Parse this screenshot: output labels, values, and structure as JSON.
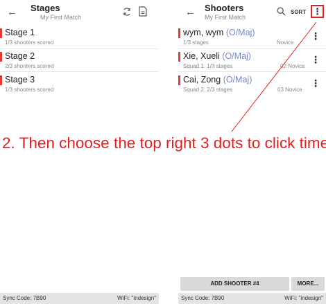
{
  "left": {
    "title": "Stages",
    "subtitle": "My First Match",
    "stages": [
      {
        "name": "Stage 1",
        "scored": "1/3 shooters scored"
      },
      {
        "name": "Stage 2",
        "scored": "2/3 shooters scored"
      },
      {
        "name": "Stage 3",
        "scored": "1/3 shooters scored"
      }
    ],
    "sync_code": "Sync Code: 7B90",
    "wifi": "WiFi: \"indesign\""
  },
  "right": {
    "title": "Shooters",
    "subtitle": "My First Match",
    "sort_label": "SORT",
    "shooters": [
      {
        "name": "wym, wym",
        "division": "(O/Maj)",
        "detail": "1/3 stages",
        "class": "Novice"
      },
      {
        "name": "Xie, Xueli",
        "division": "(O/Maj)",
        "detail": "Squad 1: 1/3 stages",
        "class": "02 Novice"
      },
      {
        "name": "Cai, Zong",
        "division": "(O/Maj)",
        "detail": "Squad 2: 2/3 stages",
        "class": "03 Novice"
      }
    ],
    "add_button": "ADD SHOOTER #4",
    "more_button": "MORE...",
    "sync_code": "Sync Code: 7B90",
    "wifi": "WiFi: \"indesign\""
  },
  "annotation": {
    "text": "2. Then choose the top right 3 dots to click time",
    "color": "#e02020"
  },
  "icons": {
    "back": "arrow-left-icon",
    "sync": "sync-icon",
    "document": "document-icon",
    "search": "search-icon",
    "more": "more-vert-icon"
  }
}
